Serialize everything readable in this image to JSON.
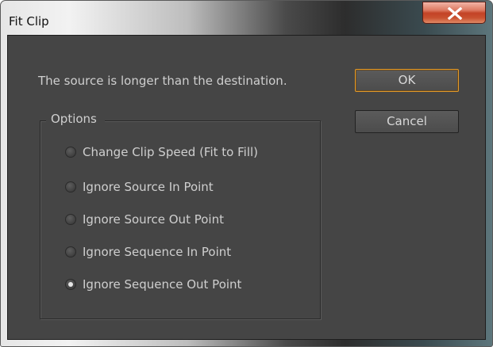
{
  "window": {
    "title": "Fit Clip",
    "close_glyph": "x"
  },
  "dialog": {
    "message": "The source is longer than the destination.",
    "ok_label": "OK",
    "cancel_label": "Cancel"
  },
  "options": {
    "legend": "Options",
    "items": [
      {
        "label": "Change Clip Speed (Fit to Fill)",
        "checked": false
      },
      {
        "label": "Ignore Source In Point",
        "checked": false
      },
      {
        "label": "Ignore Source Out Point",
        "checked": false
      },
      {
        "label": "Ignore Sequence In Point",
        "checked": false
      },
      {
        "label": "Ignore Sequence Out Point",
        "checked": true
      }
    ]
  },
  "colors": {
    "ok_border": "#e29a2b",
    "close_button": "#c34326",
    "panel_background": "#454545"
  }
}
